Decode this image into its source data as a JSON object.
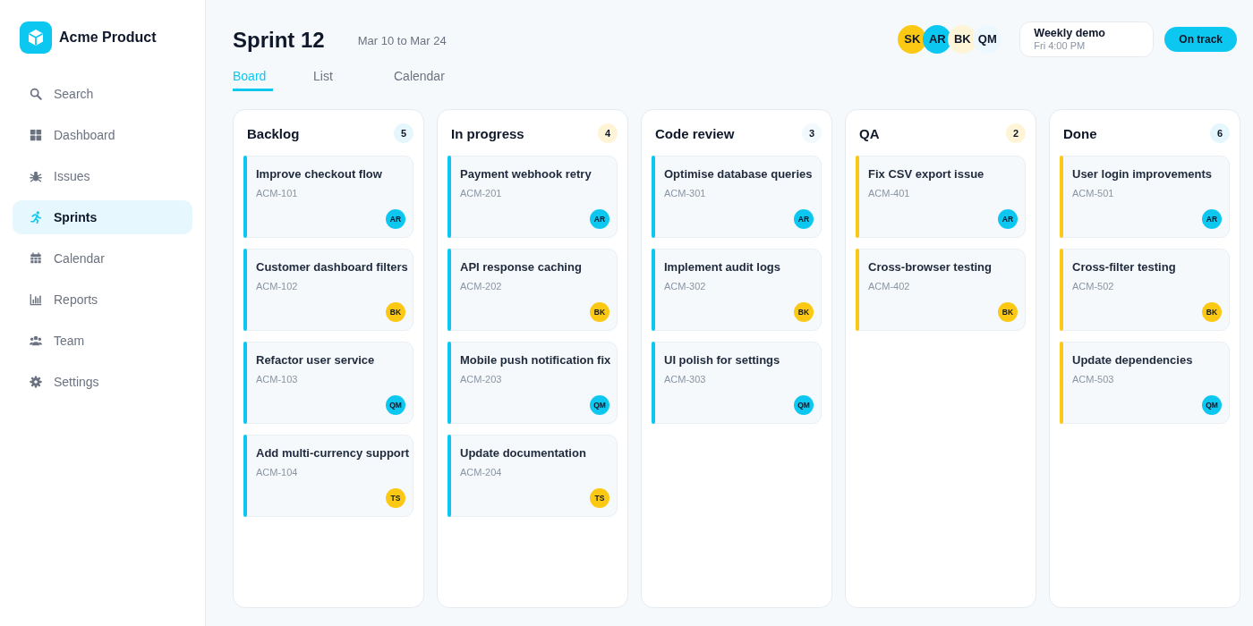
{
  "sidebar": {
    "brand": "Acme Product",
    "items": [
      {
        "label": "Search",
        "selected": false
      },
      {
        "label": "Dashboard",
        "selected": false
      },
      {
        "label": "Issues",
        "selected": false
      },
      {
        "label": "Sprints",
        "selected": true
      },
      {
        "label": "Calendar",
        "selected": false
      },
      {
        "label": "Reports",
        "selected": false
      },
      {
        "label": "Team",
        "selected": false
      },
      {
        "label": "Settings",
        "selected": false
      }
    ]
  },
  "header": {
    "title": "Sprint 12",
    "dates": "Mar 10 to Mar 24",
    "members": [
      {
        "initials": "SK",
        "color": "#fbc813"
      },
      {
        "initials": "AR",
        "color": "#0cc8f0"
      },
      {
        "initials": "BK",
        "color": "#fff5d6"
      },
      {
        "initials": "QM",
        "color": "#ecf8fe"
      }
    ],
    "event": {
      "title": "Weekly demo",
      "time": "Fri 4:00 PM"
    },
    "status": "On track"
  },
  "tabs": [
    {
      "label": "Board",
      "selected": true
    },
    {
      "label": "List",
      "selected": false
    },
    {
      "label": "Calendar",
      "selected": false
    }
  ],
  "columns": [
    {
      "title": "Backlog",
      "count": {
        "text": "5",
        "color": "#e6f6fd"
      },
      "color": "#0cc8f0",
      "cards": [
        {
          "title": "Improve checkout flow",
          "id": "ACM-101",
          "assignee": {
            "initials": "AR",
            "color": "#0cc8f0"
          }
        },
        {
          "title": "Customer dashboard filters",
          "id": "ACM-102",
          "assignee": {
            "initials": "BK",
            "color": "#fbc813"
          }
        },
        {
          "title": "Refactor user service",
          "id": "ACM-103",
          "assignee": {
            "initials": "QM",
            "color": "#0cc8f0"
          }
        },
        {
          "title": "Add multi-currency support",
          "id": "ACM-104",
          "assignee": {
            "initials": "TS",
            "color": "#fbc813"
          }
        }
      ]
    },
    {
      "title": "In progress",
      "count": {
        "text": "4",
        "color": "#fff5d6"
      },
      "color": "#0cc8f0",
      "cards": [
        {
          "title": "Payment webhook retry",
          "id": "ACM-201",
          "assignee": {
            "initials": "AR",
            "color": "#0cc8f0"
          }
        },
        {
          "title": "API response caching",
          "id": "ACM-202",
          "assignee": {
            "initials": "BK",
            "color": "#fbc813"
          }
        },
        {
          "title": "Mobile push notification fix",
          "id": "ACM-203",
          "assignee": {
            "initials": "QM",
            "color": "#0cc8f0"
          }
        },
        {
          "title": "Update documentation",
          "id": "ACM-204",
          "assignee": {
            "initials": "TS",
            "color": "#fbc813"
          }
        }
      ]
    },
    {
      "title": "Code review",
      "count": {
        "text": "3",
        "color": "#f1f9fd"
      },
      "color": "#0cc8f0",
      "cards": [
        {
          "title": "Optimise database queries",
          "id": "ACM-301",
          "assignee": {
            "initials": "AR",
            "color": "#0cc8f0"
          }
        },
        {
          "title": "Implement audit logs",
          "id": "ACM-302",
          "assignee": {
            "initials": "BK",
            "color": "#fbc813"
          }
        },
        {
          "title": "UI polish for settings",
          "id": "ACM-303",
          "assignee": {
            "initials": "QM",
            "color": "#0cc8f0"
          }
        }
      ]
    },
    {
      "title": "QA",
      "count": {
        "text": "2",
        "color": "#fff5d6"
      },
      "color": "#fbc813",
      "cards": [
        {
          "title": "Fix CSV export issue",
          "id": "ACM-401",
          "assignee": {
            "initials": "AR",
            "color": "#0cc8f0"
          }
        },
        {
          "title": "Cross-browser testing",
          "id": "ACM-402",
          "assignee": {
            "initials": "BK",
            "color": "#fbc813"
          }
        }
      ]
    },
    {
      "title": "Done",
      "count": {
        "text": "6",
        "color": "#e6f6fd"
      },
      "color": "#fbc813",
      "cards": [
        {
          "title": "User login improvements",
          "id": "ACM-501",
          "assignee": {
            "initials": "AR",
            "color": "#0cc8f0"
          }
        },
        {
          "title": "Cross-filter testing",
          "id": "ACM-502",
          "assignee": {
            "initials": "BK",
            "color": "#fbc813"
          }
        },
        {
          "title": "Update dependencies",
          "id": "ACM-503",
          "assignee": {
            "initials": "QM",
            "color": "#0cc8f0"
          }
        }
      ]
    }
  ]
}
